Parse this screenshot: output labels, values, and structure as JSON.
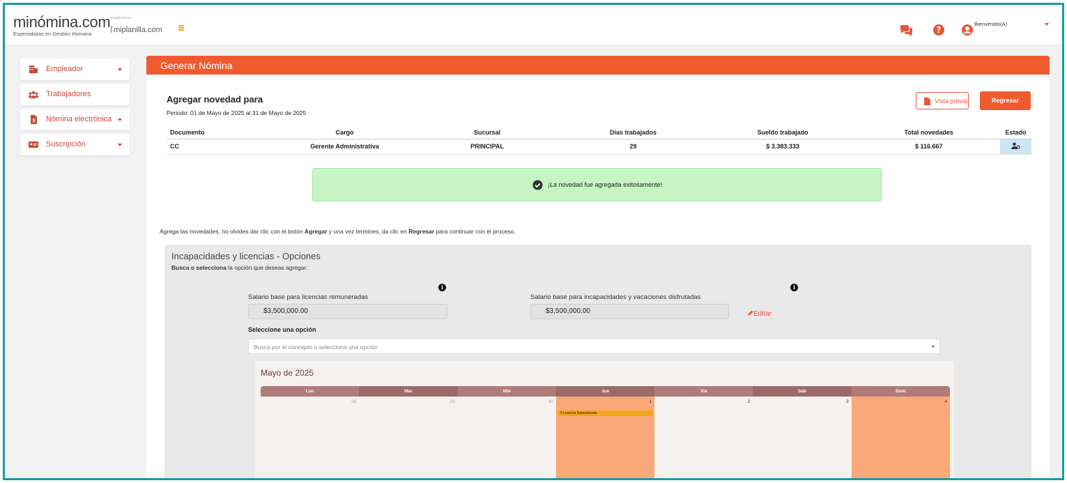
{
  "header": {
    "logo": "minómina.com",
    "logo_tagline": "Especialistas en Gestión Humana",
    "powered_by": "POWERED BY",
    "partner": "miplanilla.com",
    "welcome": "Bienvenido(A)",
    "welcome_sub": "."
  },
  "sidebar": {
    "items": [
      {
        "label": "Empleador",
        "icon": "building-icon"
      },
      {
        "label": "Trabajadores",
        "icon": "users-icon"
      },
      {
        "label": "Nómina electrónica",
        "icon": "document-icon"
      },
      {
        "label": "Suscripción",
        "icon": "id-card-icon"
      }
    ]
  },
  "main": {
    "title": "Generar Nómina",
    "section_title": "Agregar novedad para",
    "period": "Periodo: 01 de Mayo de 2025 al 31 de Mayo de 2025",
    "preview_label": "Vista previa",
    "back_label": "Regresar",
    "table": {
      "headers": [
        "Documento",
        "Cargo",
        "Sucursal",
        "Días trabajados",
        "Sueldo trabajado",
        "Total novedades",
        "Estado"
      ],
      "row": [
        "CC",
        "Gerente Administrativa",
        "PRINCIPAL",
        "29",
        "$ 3.383.333",
        "$ 116.667"
      ]
    },
    "alert": "¡La novedad fue agregada exitosamente!",
    "hint": {
      "part1": "Agrega las novedades, no olvides dar clic con el botón ",
      "bold1": "Agregar",
      "part2": " y una vez termines, da clic en ",
      "bold2": "Regresar",
      "part3": " para continuar con el proceso."
    }
  },
  "options": {
    "title": "Incapacidades y licencias - Opciones",
    "sub_bold": "Busca o selecciona",
    "sub_rest": " la opción que deseas agregar:",
    "salary_licencias_label": "Salario base para licencias remuneradas",
    "salary_licencias_value": "$3,500,000.00",
    "salary_incap_label": "Salario base para incapacidades y vacaciones disfrutadas",
    "salary_incap_value": "$3,500,000.00",
    "edit_label": "Editar",
    "select_label": "Seleccione una opción",
    "select_placeholder": "Busca por el concepto o selecciona una opción"
  },
  "calendar": {
    "title": "Mayo de 2025",
    "weekdays": [
      "Lun",
      "Mar",
      "Mié",
      "Jue",
      "Vie",
      "Sáb",
      "Dom"
    ],
    "days": [
      "28",
      "29",
      "30",
      "1",
      "2",
      "3",
      "4"
    ],
    "event_label": "0   Licencia Remunerada"
  },
  "colors": {
    "brand": "#f05a2f",
    "frame": "#1b9aa5",
    "success_bg": "#c4f5c3",
    "calendar_highlight": "#f9a877"
  }
}
